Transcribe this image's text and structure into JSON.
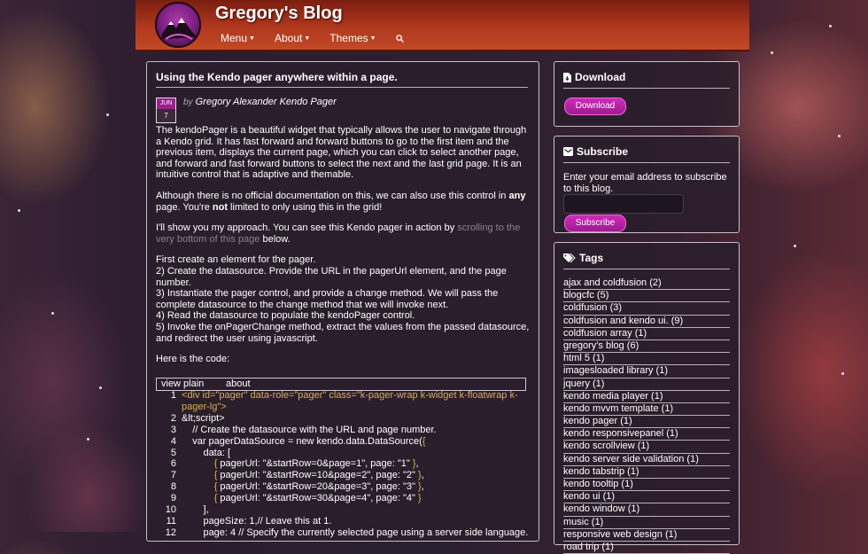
{
  "header": {
    "title": "Gregory's Blog",
    "nav": [
      {
        "label": "Menu"
      },
      {
        "label": "About"
      },
      {
        "label": "Themes"
      }
    ]
  },
  "post": {
    "title": "Using the Kendo pager anywhere within a page.",
    "date_month": "JUN",
    "date_day": "7",
    "by": "by",
    "author_line": "Gregory Alexander Kendo Pager",
    "p1": "The kendoPager is a beautiful widget that typically allows the user to navigate through a Kendo grid. It has fast forward and forward buttons to go to the first item and the previous item, displays the current page, which you can click to select another page, and forward and fast forward buttons to select the next and the last grid page. It is an intuitive control that is adaptive and themable.",
    "p2_a": "Although there is no official documentation on this, we can also use this control in ",
    "p2_b": "any",
    "p2_c": " page. You're ",
    "p2_d": "not",
    "p2_e": " limited to only using this in the grid!",
    "p3_a": "I'll show you my approach. You can see this Kendo pager in action by ",
    "p3_link": "scrolling to the very bottom of this page",
    "p3_b": " below.",
    "steps": [
      "First create an element for the pager.",
      "2) Create the datasource. Provide the URL in the pagerUrl element, and the page number.",
      "3) Instantiate the pager control, and provide a change method. We will pass the complete datasource to the change method that we will invoke next.",
      "4) Read the datasource to populate the kendoPager control.",
      "5) Invoke the onPagerChange method, extract the values from the passed datasource, and redirect the user using javascript."
    ],
    "code_intro": "Here is the code:",
    "code_view_plain": "view plain",
    "code_about": "about",
    "code_lines": [
      {
        "n": "1",
        "t": "<div id=\"pager\" data-role=\"pager\" class=\"k-pager-wrap k-widget k-floatwrap k-pager-lg\">"
      },
      {
        "n": "2",
        "t": "&lt;script>"
      },
      {
        "n": "3",
        "t": "    // Create the datasource with the URL and page number."
      },
      {
        "n": "4",
        "t": "    var pagerDataSource = new kendo.data.DataSource({"
      },
      {
        "n": "5",
        "t": "        data: ["
      },
      {
        "n": "6",
        "t": "            { pagerUrl: \"&startRow=0&page=1\", page: \"1\" },"
      },
      {
        "n": "7",
        "t": "            { pagerUrl: \"&startRow=10&page=2\", page: \"2\" },"
      },
      {
        "n": "8",
        "t": "            { pagerUrl: \"&startRow=20&page=3\", page: \"3\" },"
      },
      {
        "n": "9",
        "t": "            { pagerUrl: \"&startRow=30&page=4\", page: \"4\" }"
      },
      {
        "n": "10",
        "t": "        ],"
      },
      {
        "n": "11",
        "t": "        pageSize: 1,// Leave this at 1."
      },
      {
        "n": "12",
        "t": "        page: 4 // Specify the currently selected page using a server side language."
      }
    ]
  },
  "download": {
    "title": "Download",
    "button": "Download"
  },
  "subscribe": {
    "title": "Subscribe",
    "text": "Enter your email address to subscribe to this blog.",
    "button": "Subscribe"
  },
  "tags": {
    "title": "Tags",
    "items": [
      "ajax and coldfusion (2)",
      "blogcfc (5)",
      "coldfusion (3)",
      "coldfusion and kendo ui. (9)",
      "coldfusion array (1)",
      "gregory's blog (6)",
      "html 5 (1)",
      "imagesloaded library (1)",
      "jquery (1)",
      "kendo media player (1)",
      "kendo mvvm template (1)",
      "kendo pager (1)",
      "kendo responsivepanel (1)",
      "kendo scrollview (1)",
      "kendo server side validation (1)",
      "kendo tabstrip (1)",
      "kendo tooltip (1)",
      "kendo ui (1)",
      "kendo window (1)",
      "music (1)",
      "responsive web design (1)",
      "road trip (1)"
    ]
  },
  "colors": {
    "accent": "#b0229f",
    "header": "#b0381e"
  }
}
